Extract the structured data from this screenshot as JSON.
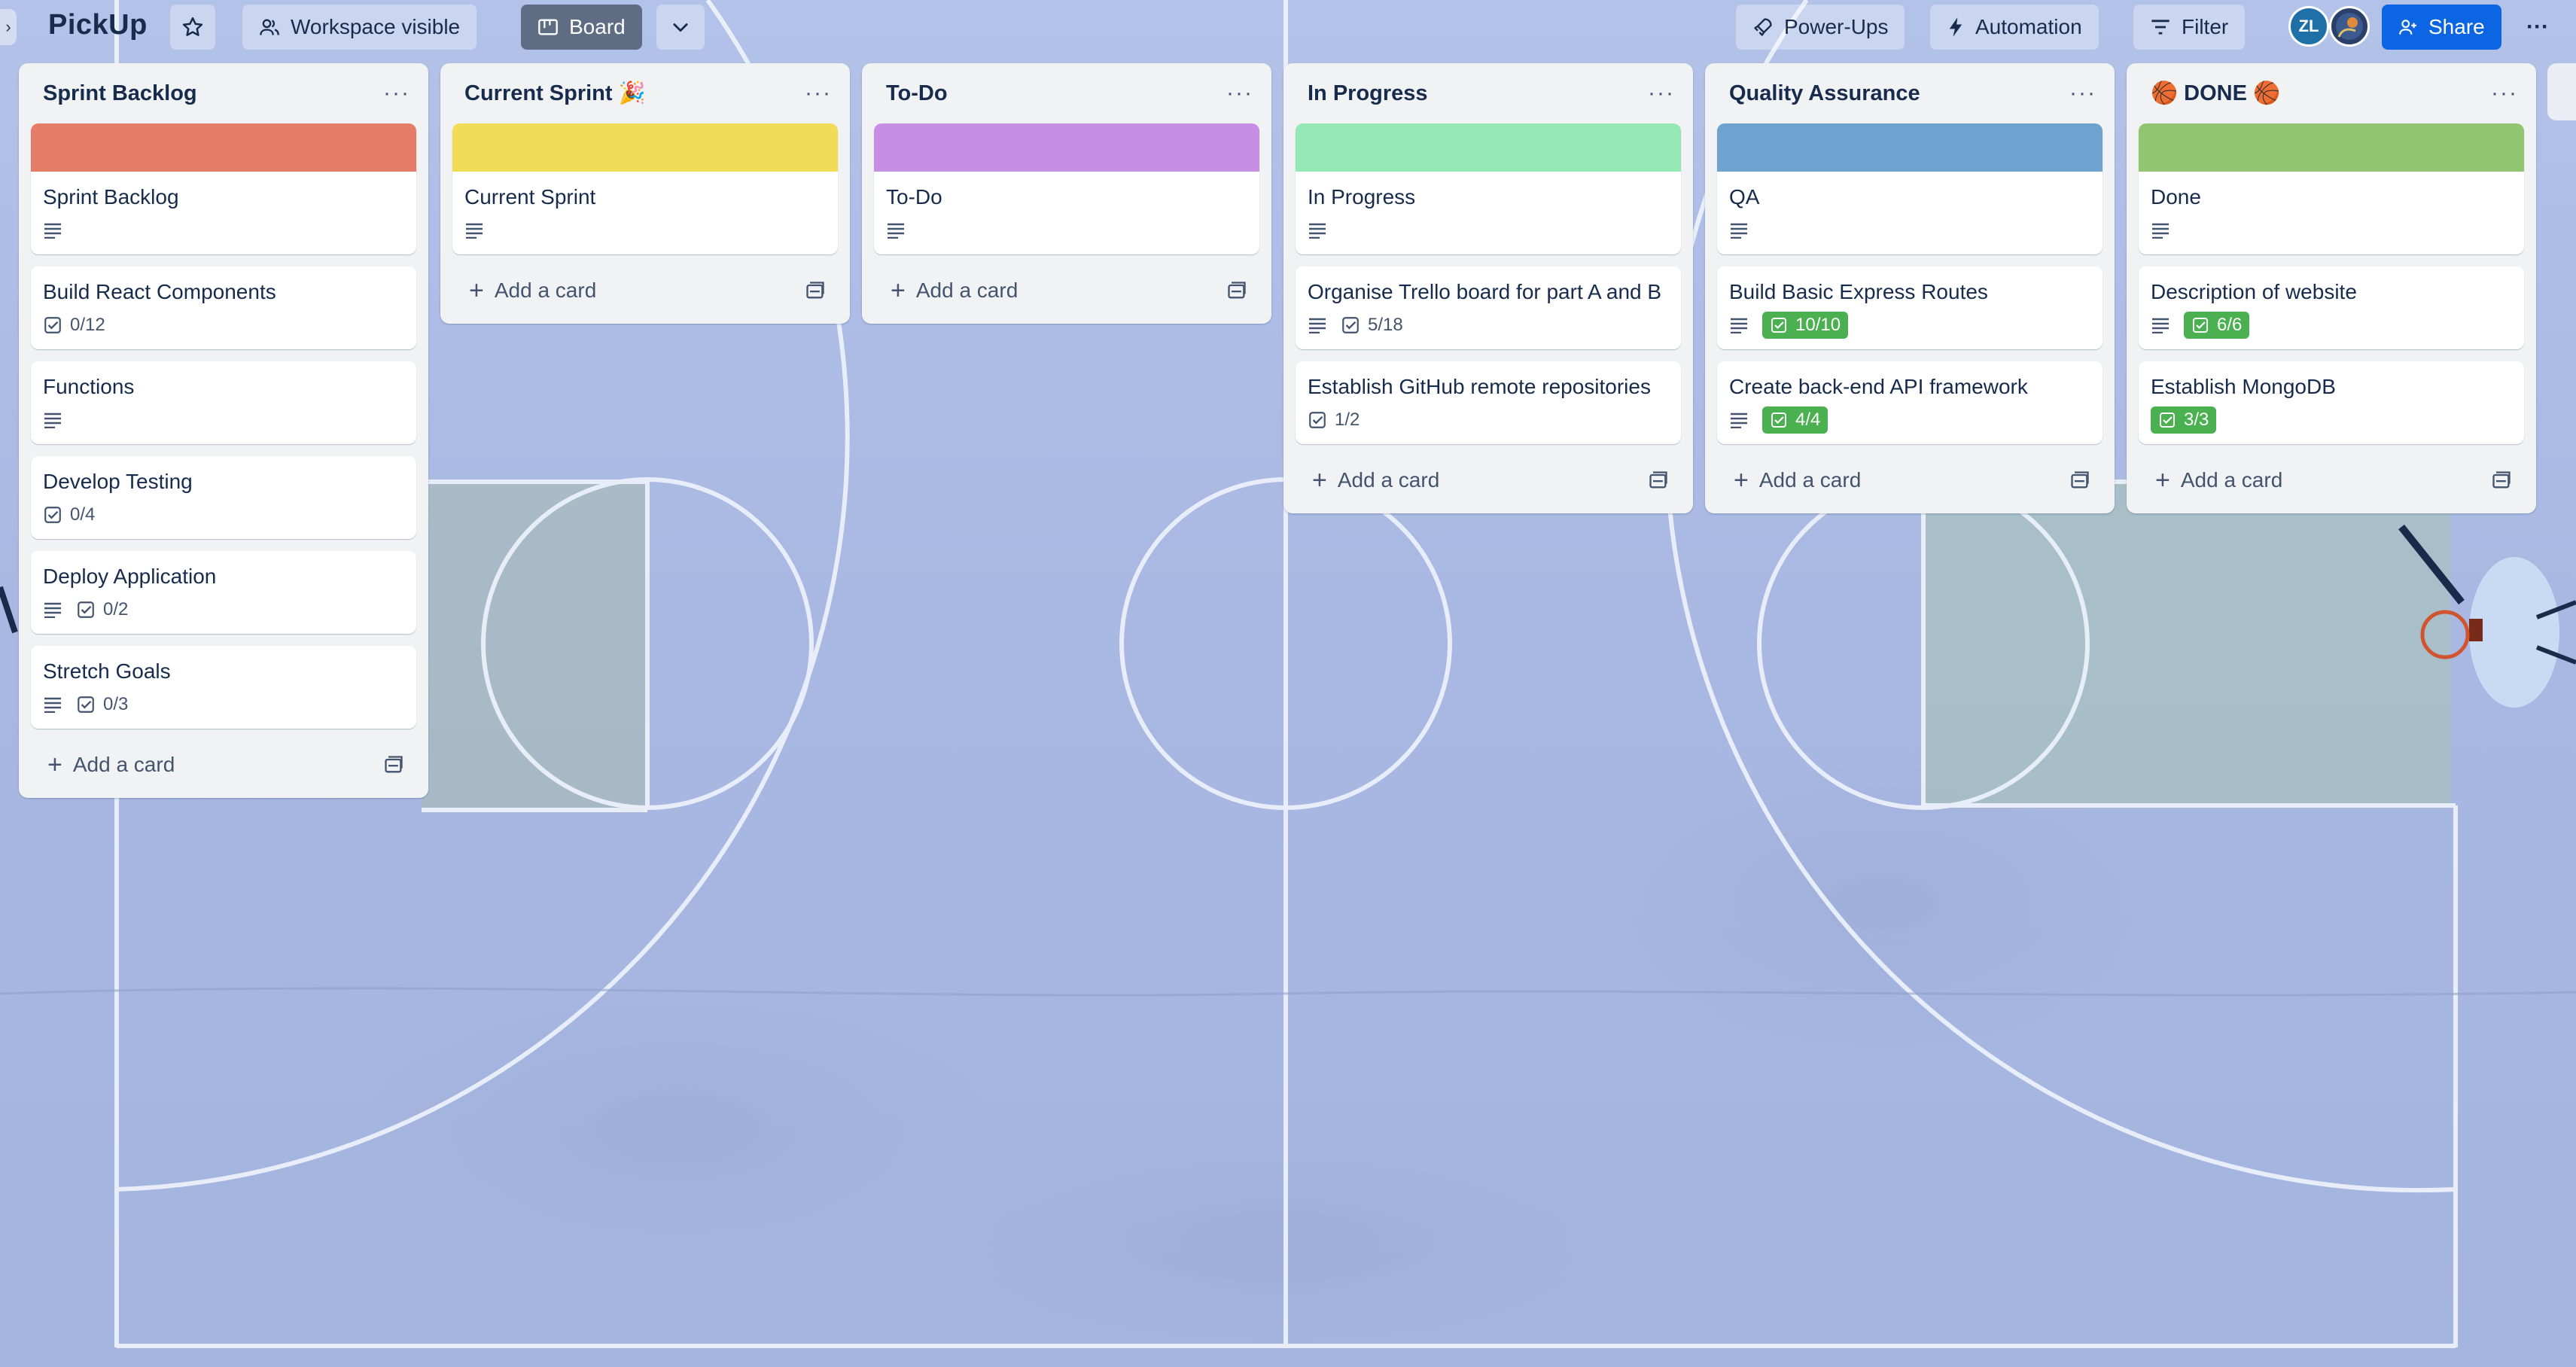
{
  "header": {
    "board_title": "PickUp",
    "collapse_glyph": "›",
    "visibility_label": "Workspace visible",
    "view_label": "Board",
    "powerups_label": "Power-Ups",
    "automation_label": "Automation",
    "filter_label": "Filter",
    "avatar_initials": "ZL",
    "share_label": "Share",
    "more_glyph": "···"
  },
  "colors": {
    "sprint_backlog": "#e57c68",
    "current_sprint": "#f0dc57",
    "todo": "#c68fe3",
    "in_progress": "#93e8b4",
    "qa": "#6ea3cf",
    "done": "#92c571",
    "complete_badge": "#4bb050",
    "accent": "#0c66e4"
  },
  "lists": [
    {
      "title": "Sprint Backlog",
      "add_label": "Add a card",
      "cards": [
        {
          "title": "Sprint Backlog"
        },
        {
          "title": "Build React Components",
          "checklist": "0/12"
        },
        {
          "title": "Functions"
        },
        {
          "title": "Develop Testing",
          "checklist": "0/4"
        },
        {
          "title": "Deploy Application",
          "checklist": "0/2"
        },
        {
          "title": "Stretch Goals",
          "checklist": "0/3"
        }
      ]
    },
    {
      "title": "Current Sprint 🎉",
      "add_label": "Add a card",
      "cards": [
        {
          "title": "Current Sprint"
        }
      ]
    },
    {
      "title": "To-Do",
      "add_label": "Add a card",
      "cards": [
        {
          "title": "To-Do"
        }
      ]
    },
    {
      "title": "In Progress",
      "add_label": "Add a card",
      "cards": [
        {
          "title": "In Progress"
        },
        {
          "title": "Organise Trello board for part A and B",
          "checklist": "5/18"
        },
        {
          "title": "Establish GitHub remote repositories",
          "checklist": "1/2"
        }
      ]
    },
    {
      "title": "Quality Assurance",
      "add_label": "Add a card",
      "cards": [
        {
          "title": "QA"
        },
        {
          "title": "Build Basic Express Routes",
          "checklist": "10/10"
        },
        {
          "title": "Create back-end API framework",
          "checklist": "4/4"
        }
      ]
    },
    {
      "title": "🏀 DONE 🏀",
      "add_label": "Add a card",
      "cards": [
        {
          "title": "Done"
        },
        {
          "title": "Description of website",
          "checklist": "6/6"
        },
        {
          "title": "Establish MongoDB",
          "checklist": "3/3"
        }
      ]
    }
  ]
}
